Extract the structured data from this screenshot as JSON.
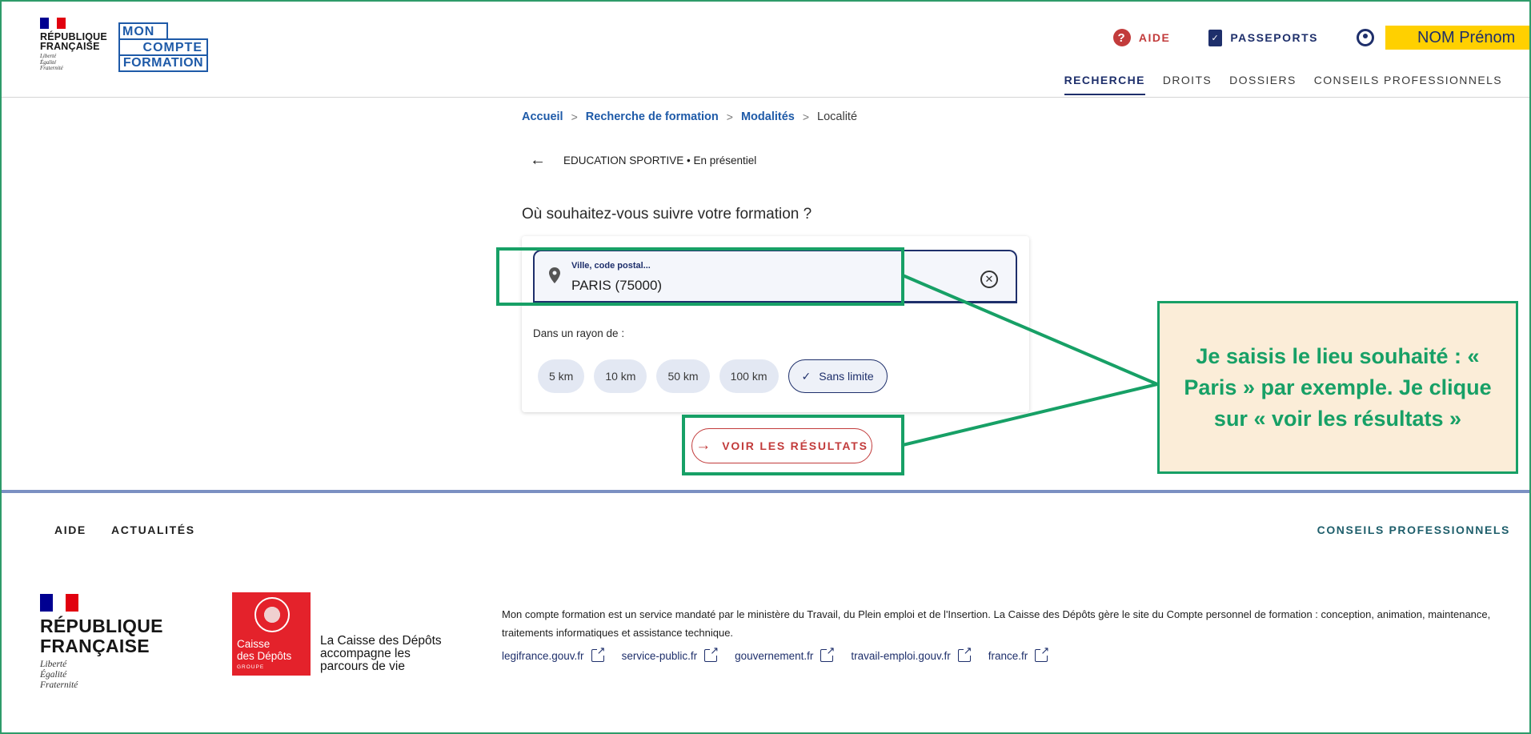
{
  "header": {
    "republic": {
      "line1": "RÉPUBLIQUE",
      "line2": "FRANÇAISE",
      "motto1": "Liberté",
      "motto2": "Égalité",
      "motto3": "Fraternité"
    },
    "brand": {
      "line1": "MON",
      "line2": "COMPTE",
      "line3": "FORMATION"
    },
    "top_links": {
      "help": "AIDE",
      "passports": "PASSEPORTS"
    },
    "username": "NOM Prénom",
    "nav": [
      "RECHERCHE",
      "DROITS",
      "DOSSIERS",
      "CONSEILS PROFESSIONNELS"
    ]
  },
  "breadcrumb": [
    "Accueil",
    "Recherche de formation",
    "Modalités",
    "Localité"
  ],
  "back_label": "EDUCATION SPORTIVE • En présentiel",
  "question": "Où souhaitez-vous suivre votre formation ?",
  "location_input": {
    "label": "Ville, code postal...",
    "value": "PARIS (75000)"
  },
  "radius": {
    "label": "Dans un rayon de :",
    "options": [
      "5 km",
      "10 km",
      "50 km",
      "100 km",
      "Sans limite"
    ],
    "selected": "Sans limite"
  },
  "cta": "VOIR LES RÉSULTATS",
  "annotation": {
    "text": "Je saisis le lieu souhaité : « Paris » par exemple. Je clique  sur « voir les résultats »",
    "color": "#17a066",
    "fill": "#fbedd8"
  },
  "footer": {
    "nav_left": [
      "AIDE",
      "ACTUALITÉS"
    ],
    "nav_right": "CONSEILS PROFESSIONNELS",
    "republic": {
      "line1": "RÉPUBLIQUE",
      "line2": "FRANÇAISE",
      "motto1": "Liberté",
      "motto2": "Égalité",
      "motto3": "Fraternité"
    },
    "cdc": {
      "line1": "Caisse",
      "line2": "des Dépôts",
      "line3": "GROUPE",
      "slogan": "La Caisse des Dépôts accompagne les parcours de vie"
    },
    "description": "Mon compte formation est un service mandaté par le ministère du Travail, du Plein emploi et de l'Insertion. La Caisse des Dépôts gère le site du Compte personnel de formation : conception, animation, maintenance, traitements informatiques et assistance technique.",
    "links": [
      "legifrance.gouv.fr",
      "service-public.fr",
      "gouvernement.fr",
      "travail-emploi.gouv.fr",
      "france.fr"
    ]
  },
  "colors": {
    "primary": "#1e2f6b",
    "accent_red": "#c23b3b",
    "highlight_yellow": "#ffd000",
    "link_blue": "#1e5aa8"
  }
}
